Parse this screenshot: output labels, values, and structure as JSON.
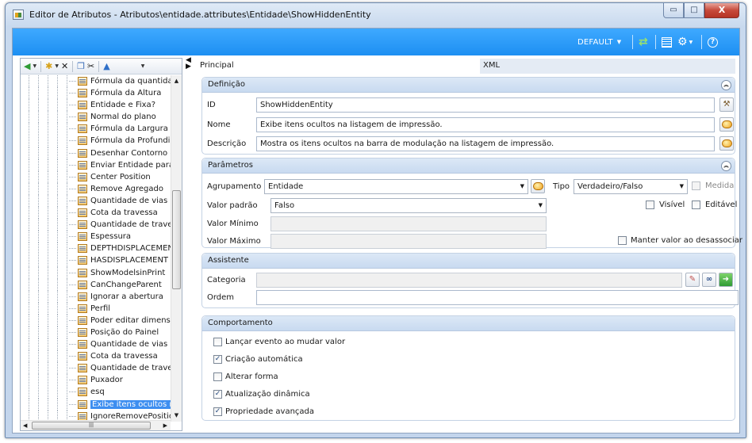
{
  "window": {
    "title": "Editor de Atributos - Atributos\\entidade.attributes\\Entidade\\ShowHiddenEntity",
    "minimize_glyph": "▭",
    "maximize_glyph": "□",
    "close_glyph": "X"
  },
  "topbar": {
    "profile_label": "DEFAULT",
    "icons": [
      "refresh-icon",
      "layout-icon",
      "settings-icon",
      "help-icon"
    ]
  },
  "tree_toolbar": {
    "icons": [
      "back-icon",
      "new-icon",
      "delete-icon",
      "copy-icon",
      "cut-icon",
      "move-up-icon"
    ]
  },
  "tree": {
    "items": [
      {
        "label": "Fórmula da quantidade c"
      },
      {
        "label": "Fórmula da Altura"
      },
      {
        "label": "Entidade e Fixa?"
      },
      {
        "label": "Normal do plano"
      },
      {
        "label": "Fórmula da Largura"
      },
      {
        "label": "Fórmula da Profundidad"
      },
      {
        "label": "Desenhar Contorno da M"
      },
      {
        "label": "Enviar Entidade para Dy"
      },
      {
        "label": "Center Position"
      },
      {
        "label": "Remove Agregado"
      },
      {
        "label": "Quantidade de vias"
      },
      {
        "label": "Cota da travessa"
      },
      {
        "label": "Quantidade de travessa"
      },
      {
        "label": "Espessura"
      },
      {
        "label": "DEPTHDISPLACEMENT"
      },
      {
        "label": "HASDISPLACEMENT"
      },
      {
        "label": "ShowModelsinPrint"
      },
      {
        "label": "CanChangeParent"
      },
      {
        "label": "Ignorar a abertura"
      },
      {
        "label": "Perfil"
      },
      {
        "label": "Poder editar dimensões"
      },
      {
        "label": "Posição do Painel"
      },
      {
        "label": "Quantidade de vias"
      },
      {
        "label": "Cota da travessa"
      },
      {
        "label": "Quantidade de travessa"
      },
      {
        "label": "Puxador"
      },
      {
        "label": "esq"
      },
      {
        "label": "Exibe itens ocultos na li",
        "selected": true
      },
      {
        "label": "IgnoreRemovePosition"
      }
    ]
  },
  "tabs": {
    "principal": "Principal",
    "xml": "XML"
  },
  "definicao": {
    "header": "Definição",
    "id_label": "ID",
    "id_value": "ShowHiddenEntity",
    "nome_label": "Nome",
    "nome_value": "Exibe itens ocultos na listagem de impressão.",
    "descricao_label": "Descrição",
    "descricao_value": "Mostra os itens ocultos na barra de modulação na listagem de impressão."
  },
  "parametros": {
    "header": "Parâmetros",
    "agrupamento_label": "Agrupamento",
    "agrupamento_value": "Entidade",
    "tipo_label": "Tipo",
    "tipo_value": "Verdadeiro/Falso",
    "medida_label": "Medida",
    "medida_checked": false,
    "valor_padrao_label": "Valor padrão",
    "valor_padrao_value": "Falso",
    "visivel_label": "Visível",
    "visivel_checked": false,
    "editavel_label": "Editável",
    "editavel_checked": false,
    "valor_minimo_label": "Valor Mínimo",
    "valor_minimo_value": "",
    "valor_maximo_label": "Valor Máximo",
    "valor_maximo_value": "",
    "manter_label": "Manter valor ao desassociar",
    "manter_checked": false
  },
  "assistente": {
    "header": "Assistente",
    "categoria_label": "Categoria",
    "categoria_value": "",
    "ordem_label": "Ordem",
    "ordem_value": ""
  },
  "comportamento": {
    "header": "Comportamento",
    "options": [
      {
        "label": "Lançar evento ao mudar valor",
        "checked": false
      },
      {
        "label": "Criação automática",
        "checked": true
      },
      {
        "label": "Alterar forma",
        "checked": false
      },
      {
        "label": "Atualização dinâmica",
        "checked": true
      },
      {
        "label": "Propriedade avançada",
        "checked": true
      }
    ]
  },
  "colors": {
    "accent_bar": "#1d8ff2",
    "section_header": "#c8daf0",
    "selection": "#3d8ef0"
  }
}
